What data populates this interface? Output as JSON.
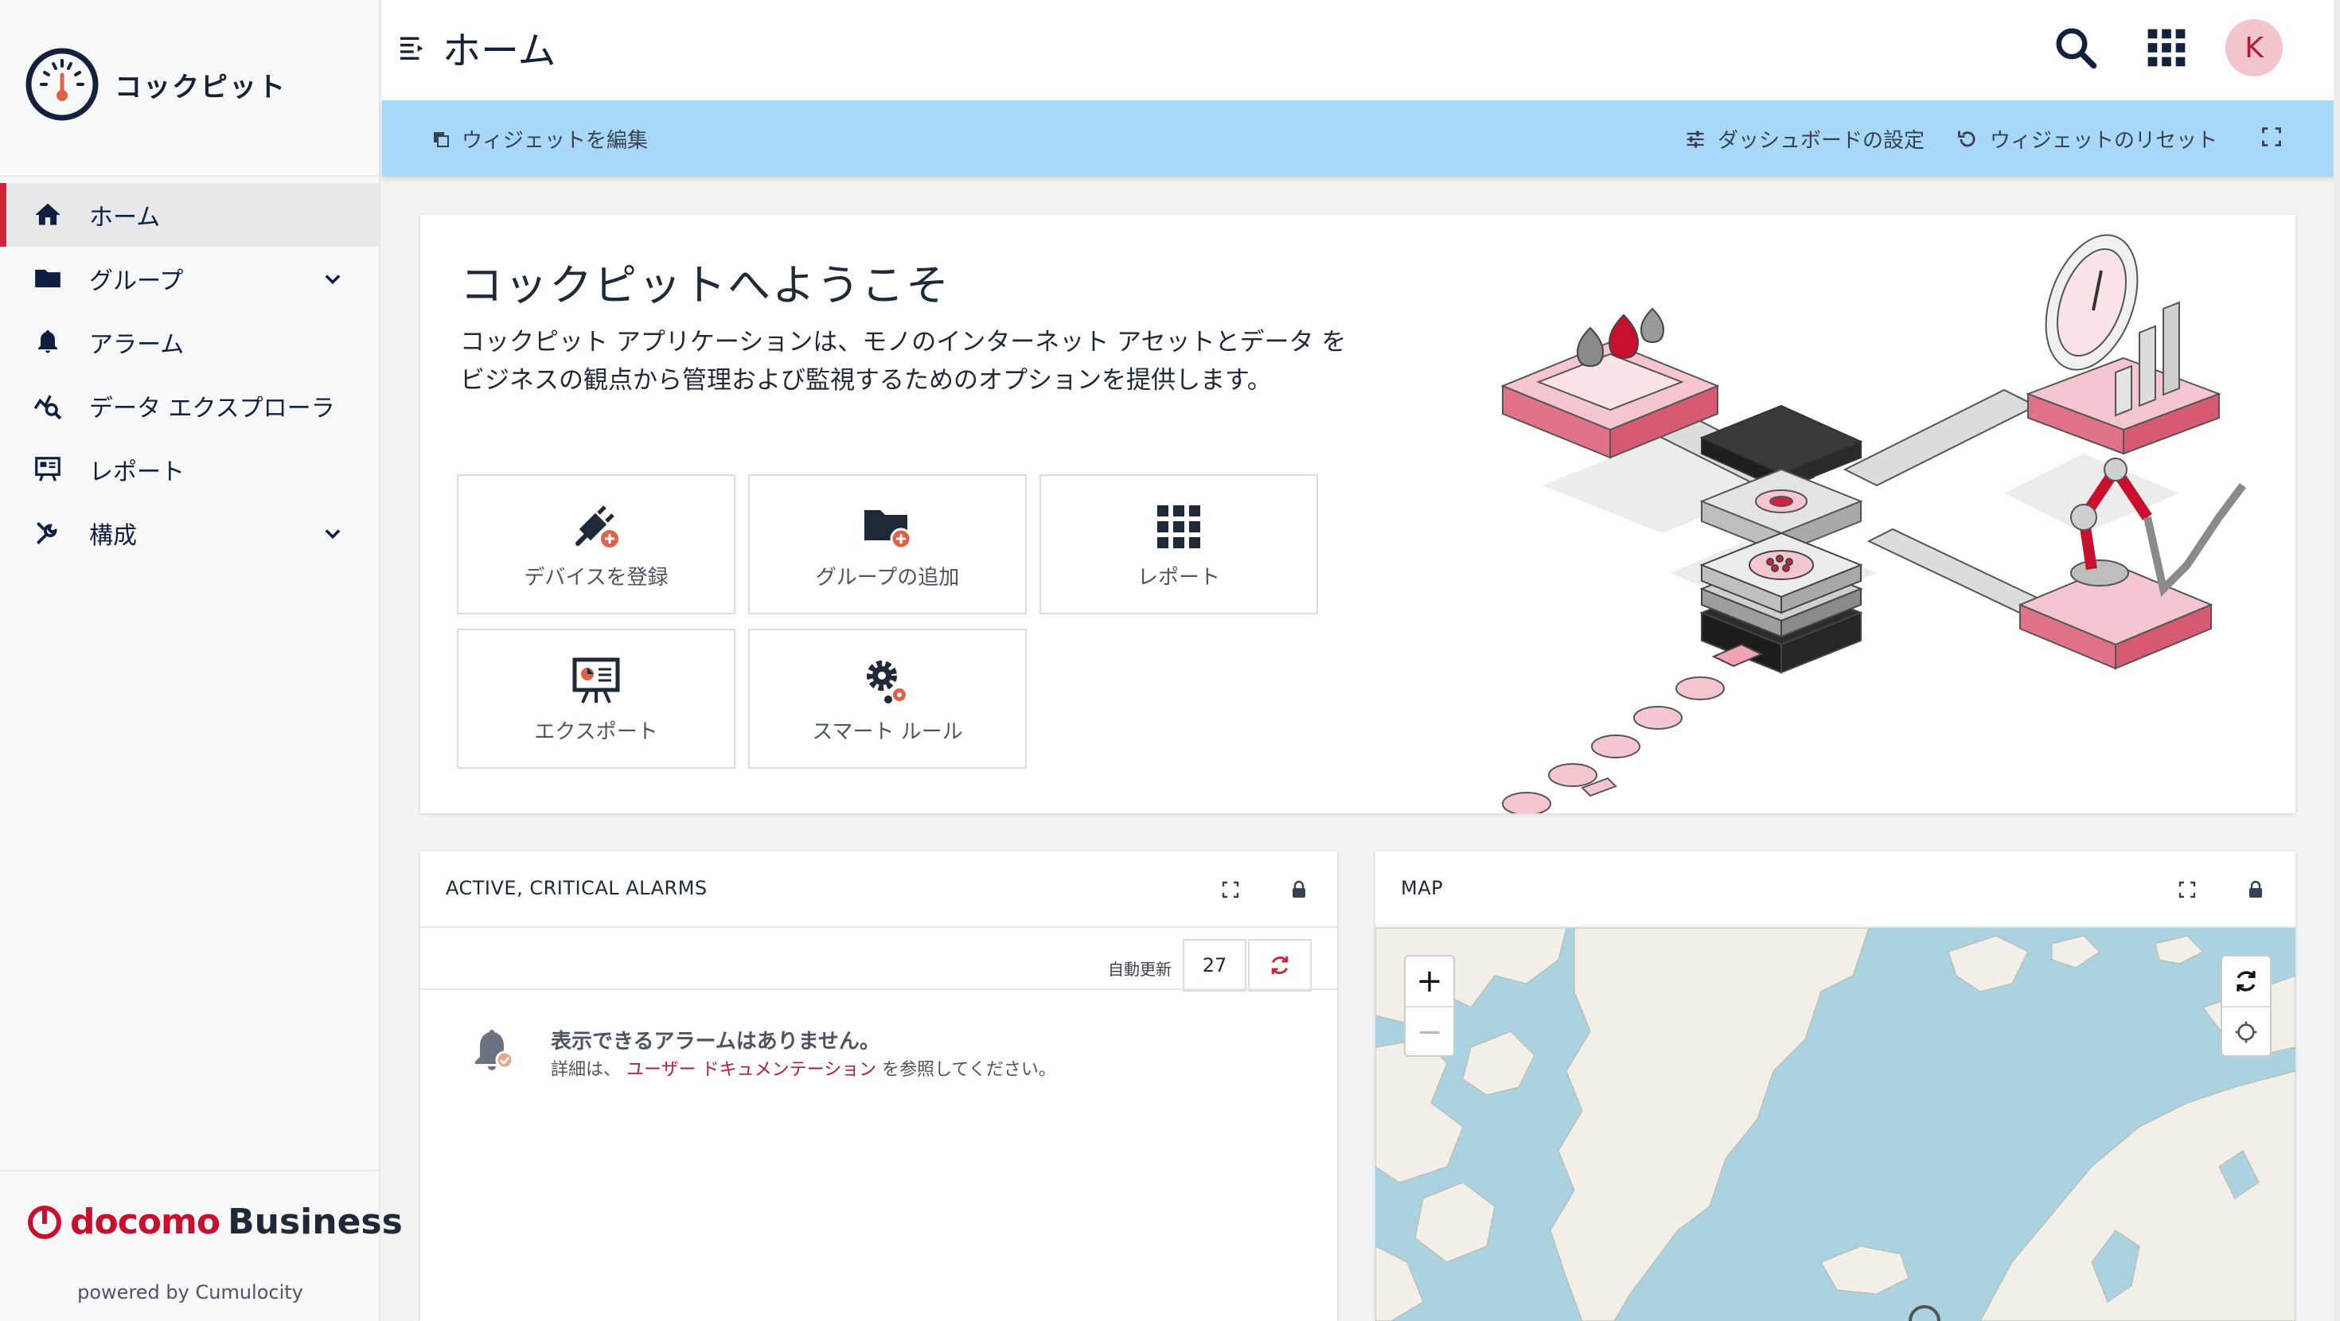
{
  "app": {
    "name": "コックピット"
  },
  "header": {
    "title": "ホーム",
    "avatar_initial": "K"
  },
  "sidebar": {
    "items": [
      {
        "label": "ホーム",
        "icon": "home-icon"
      },
      {
        "label": "グループ",
        "icon": "folder-icon"
      },
      {
        "label": "アラーム",
        "icon": "bell-icon"
      },
      {
        "label": "データ エクスプローラ",
        "icon": "data-explorer-icon"
      },
      {
        "label": "レポート",
        "icon": "report-icon"
      },
      {
        "label": "構成",
        "icon": "configuration-icon"
      }
    ],
    "footer": {
      "brand_docomo": "docomo",
      "brand_business": "Business",
      "powered_by": "powered by Cumulocity"
    }
  },
  "action_bar": {
    "edit_widgets": "ウィジェットを編集",
    "dashboard_settings": "ダッシュボードの設定",
    "reset_widgets": "ウィジェットのリセット"
  },
  "welcome": {
    "title": "コックピットへようこそ",
    "text": "コックピット アプリケーションは、モノのインターネット アセットとデータ をビジネスの観点から管理および監視するためのオプションを提供します。",
    "quick_links": [
      {
        "label": "デバイスを登録",
        "icon": "plug-add-icon"
      },
      {
        "label": "グループの追加",
        "icon": "folder-add-icon"
      },
      {
        "label": "レポート",
        "icon": "grid-icon"
      },
      {
        "label": "エクスポート",
        "icon": "presentation-icon"
      },
      {
        "label": "スマート ルール",
        "icon": "gears-icon"
      }
    ]
  },
  "alarms_widget": {
    "title": "ACTIVE, CRITICAL ALARMS",
    "auto_refresh_label": "自動更新",
    "countdown": "27",
    "empty_title": "表示できるアラームはありません。",
    "empty_prefix": "詳細は、",
    "empty_link": "ユーザー ドキュメンテーション",
    "empty_suffix": " を参照してください。"
  },
  "map_widget": {
    "title": "MAP",
    "zoom_in": "+",
    "zoom_out": "−"
  },
  "colors": {
    "accent": "#d0243a",
    "action_bar": "#a8d8f8",
    "navy": "#14213d",
    "water": "#aad3df",
    "land": "#f2efe9"
  }
}
